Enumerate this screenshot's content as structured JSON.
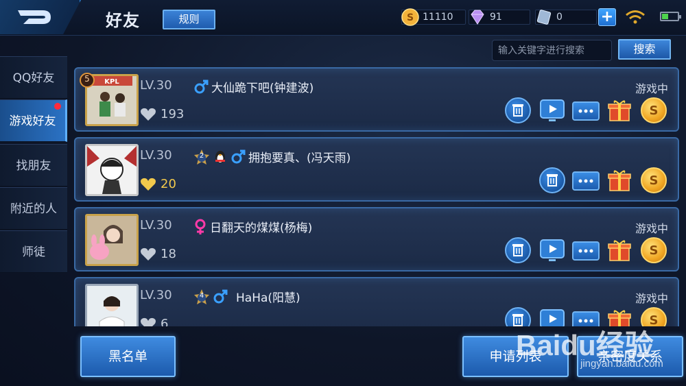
{
  "header": {
    "title": "好友",
    "rules_label": "规则"
  },
  "currency": {
    "gold": "11110",
    "diamond": "91",
    "voucher": "0"
  },
  "sidebar": {
    "items": [
      {
        "label": "QQ好友",
        "active": false
      },
      {
        "label": "游戏好友",
        "active": true,
        "badge": true
      },
      {
        "label": "找朋友",
        "active": false
      },
      {
        "label": "附近的人",
        "active": false
      },
      {
        "label": "师徒",
        "active": false
      }
    ]
  },
  "search": {
    "placeholder": "输入关键字进行搜索",
    "button_label": "搜索"
  },
  "friends": [
    {
      "level": "LV.30",
      "name": "大仙跪下吧(钟建波)",
      "gender": "male",
      "intimacy": "193",
      "status": "游戏中",
      "rank_badge": "5"
    },
    {
      "level": "LV.30",
      "name": "拥抱要真、(冯天雨)",
      "gender": "male",
      "intimacy": "20",
      "status": "",
      "rank_badge": "2"
    },
    {
      "level": "LV.30",
      "name": "日翻天的煤煤(杨梅)",
      "gender": "female",
      "intimacy": "18",
      "status": "游戏中",
      "rank_badge": ""
    },
    {
      "level": "LV.30",
      "name": "HaHa(阳慧)",
      "gender": "male",
      "intimacy": "6",
      "status": "游戏中",
      "rank_badge": "4"
    }
  ],
  "bottom": {
    "blacklist_label": "黑名单",
    "requests_label": "申请列表",
    "intimacy_label": "亲密度关系"
  },
  "watermark": {
    "brand": "Baidu经验",
    "url": "jingyan.baidu.com"
  },
  "colors": {
    "accent_blue": "#3f8be0",
    "male": "#3aa0ff",
    "female": "#ff3aa8",
    "gold": "#f2c94c",
    "alert_red": "#ff2a3c"
  }
}
